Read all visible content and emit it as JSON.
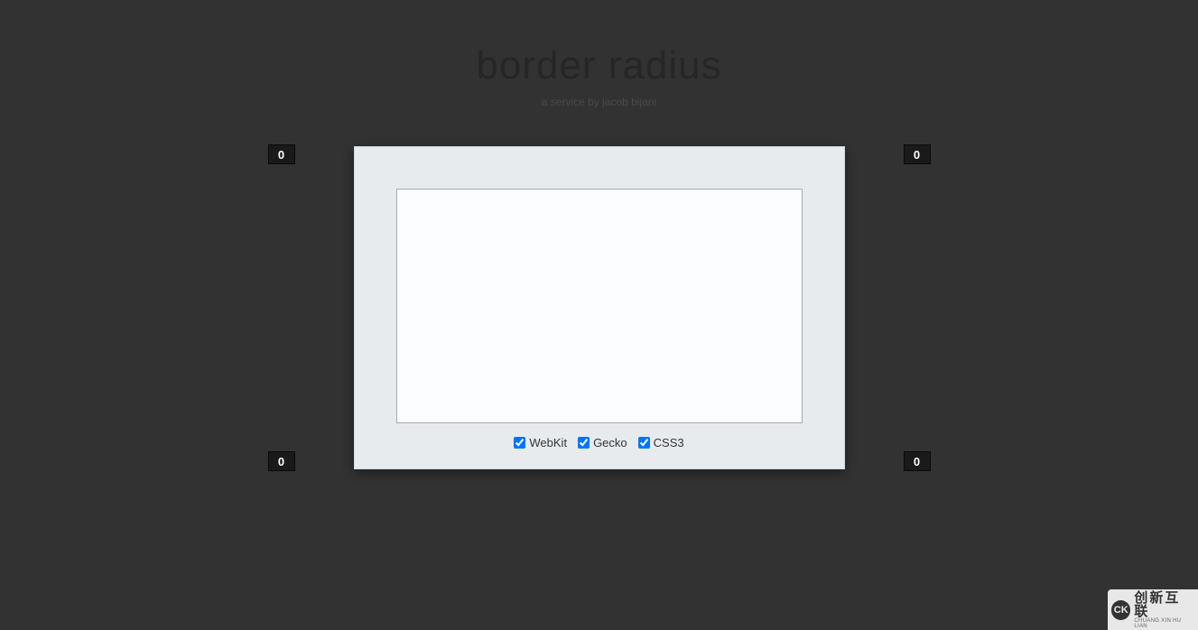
{
  "title": "border radius",
  "subtitle": "a service by jacob bijani",
  "corners": {
    "top_left": "0",
    "top_right": "0",
    "bottom_left": "0",
    "bottom_right": "0"
  },
  "checkboxes": {
    "webkit": {
      "label": "WebKit",
      "checked": true
    },
    "gecko": {
      "label": "Gecko",
      "checked": true
    },
    "css3": {
      "label": "CSS3",
      "checked": true
    }
  },
  "watermark": {
    "icon_text": "CK",
    "main_text": "创新互联",
    "sub_text": "CHUANG XIN HU LIAN"
  }
}
